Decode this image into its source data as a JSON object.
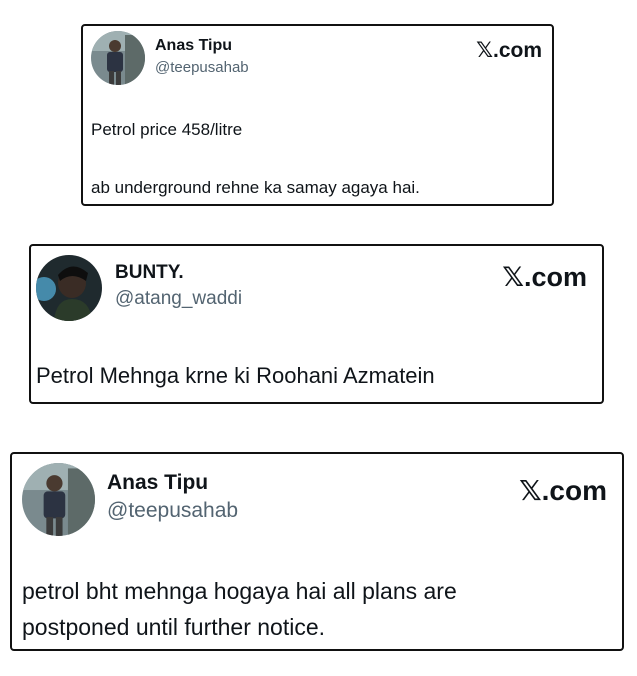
{
  "posts": [
    {
      "display_name": "Anas Tipu",
      "handle": "@teepusahab",
      "brand_mark": "𝕏",
      "brand_domain": ".com",
      "lines": [
        "Petrol price 458/litre",
        "ab underground rehne ka samay agaya hai."
      ],
      "avatar": "man-standing-photo"
    },
    {
      "display_name": "BUNTY.",
      "handle": "@atang_waddi",
      "brand_mark": "𝕏",
      "brand_domain": ".com",
      "lines": [
        "Petrol Mehnga krne ki Roohani Azmatein"
      ],
      "avatar": "dark-portrait-photo"
    },
    {
      "display_name": "Anas Tipu",
      "handle": "@teepusahab",
      "brand_mark": "𝕏",
      "brand_domain": ".com",
      "lines": [
        "petrol bht mehnga hogaya hai all plans are",
        "postponed until further notice."
      ],
      "avatar": "man-standing-photo"
    }
  ],
  "colors": {
    "text_primary": "#0f1419",
    "text_secondary": "#536471",
    "card_border": "#111111"
  }
}
